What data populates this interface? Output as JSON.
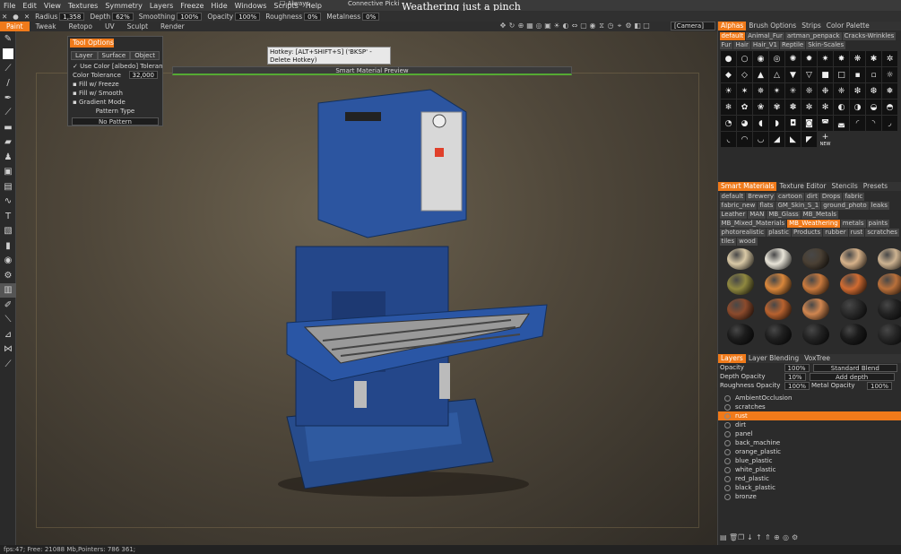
{
  "menu": [
    "File",
    "Edit",
    "View",
    "Textures",
    "Symmetry",
    "Layers",
    "Freeze",
    "Hide",
    "Windows",
    "Scripts",
    "Help"
  ],
  "toolbar": {
    "radius_label": "Radius",
    "radius": "1,358",
    "depth_label": "Depth",
    "depth": "62%",
    "smoothing_label": "Smoothing",
    "smoothing": "100%",
    "opacity_label": "Opacity",
    "opacity": "100%",
    "roughness_label": "Roughness",
    "roughness": "0%",
    "metalness_label": "Metalness",
    "metalness": "0%",
    "always": "Always",
    "connective": "Connective Picki"
  },
  "overlay_title": "Weathering just a pinch",
  "mode_tabs": [
    "Paint",
    "Tweak",
    "Retopo",
    "UV",
    "Sculpt",
    "Render"
  ],
  "camera": "[Camera]",
  "tool_options": {
    "title": "Tool Options",
    "tabs": [
      "Layer",
      "Surface",
      "Object"
    ],
    "use_color": "✓ Use Color [albedo] Toleranc",
    "color_tolerance": "Color Tolerance",
    "color_tolerance_val": "32,000",
    "fill_freeze": "Fill w/ Freeze",
    "fill_smooth": "Fill w/ Smooth",
    "gradient": "Gradient Mode",
    "pattern_type": "Pattern Type",
    "pattern": "No Pattern"
  },
  "hotkey": "Hotkey: [ALT+SHIFT+S] ('BKSP' - Delete Hotkey)",
  "smart_preview": "Smart Material Preview",
  "alphas": {
    "tabs": [
      "Alphas",
      "Brush Options",
      "Strips",
      "Color Palette"
    ],
    "chips": [
      "default",
      "Animal_Fur",
      "artman_penpack",
      "Cracks-Wrinkles",
      "Fur",
      "Hair",
      "Hair_V1",
      "Reptile",
      "Skin-Scales"
    ],
    "new_label": "NEW"
  },
  "smart_materials": {
    "tabs": [
      "Smart Materials",
      "Texture Editor",
      "Stencils",
      "Presets"
    ],
    "chips": [
      "default",
      "Brewery",
      "cartoon",
      "dirt",
      "Drops",
      "fabric",
      "fabric_new",
      "flats",
      "GM_Skin_S_1",
      "ground_photo",
      "leaks",
      "Leather",
      "MAN",
      "MB_Glass",
      "MB_Metals",
      "MB_Mixed_Materials",
      "MB_Weathering",
      "metals",
      "paints",
      "photorealistic",
      "plastic",
      "Products",
      "rubber",
      "rust",
      "scratches",
      "tiles",
      "wood"
    ],
    "active": "MB_Weathering",
    "sphere_colors": [
      "#d9c9a6",
      "#e8e4d8",
      "#4a4034",
      "#d7b28a",
      "#cdb391",
      "#8f8840",
      "#d9873c",
      "#c97a3e",
      "#cf6b32",
      "#b9703b",
      "#8b4a2c",
      "#b8622f",
      "#d08650",
      "#2a2a2a",
      "#222222",
      "#1c1c1c",
      "#1f1f1f",
      "#232323",
      "#1b1b1b",
      "#262626"
    ]
  },
  "layers": {
    "tabs": [
      "Layers",
      "Layer Blending",
      "VoxTree"
    ],
    "opacity_label": "Opacity",
    "opacity": "100%",
    "blend": "Standard Blend",
    "depth_label": "Depth Opacity",
    "depth": "10%",
    "depth_mode": "Add depth",
    "rough_label": "Roughness Opacity",
    "rough": "100%",
    "metal_label": "Metal Opacity",
    "metal": "100%",
    "items": [
      "AmbientOcclusion",
      "scratches",
      "rust",
      "dirt",
      "panel",
      "back_machine",
      "orange_plastic",
      "blue_plastic",
      "white_plastic",
      "red_plastic",
      "black_plastic",
      "bronze"
    ],
    "active": "rust"
  },
  "status": "fps:47;    Free: 21088 Mb,Pointers: 786 361;"
}
